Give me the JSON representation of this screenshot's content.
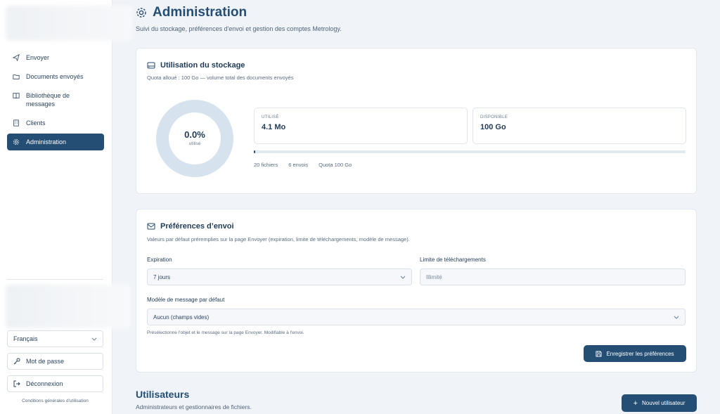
{
  "sidebar": {
    "items": [
      {
        "label": "Envoyer",
        "icon": "send-icon",
        "active": false
      },
      {
        "label": "Documents envoyés",
        "icon": "folder-icon",
        "active": false
      },
      {
        "label": "Bibliothèque de messages",
        "icon": "book-icon",
        "active": false
      },
      {
        "label": "Clients",
        "icon": "building-icon",
        "active": false
      },
      {
        "label": "Administration",
        "icon": "gear-icon",
        "active": true
      }
    ],
    "language": "Français",
    "password_label": "Mot de passe",
    "logout_label": "Déconnexion",
    "terms_label": "Conditions générales d'utilisation"
  },
  "header": {
    "title": "Administration",
    "subtitle": "Suivi du stockage, préférences d'envoi et gestion des comptes Metrology."
  },
  "storage": {
    "title": "Utilisation du stockage",
    "description": "Quota alloué : 100 Go — volume total des documents envoyés",
    "percent_label": "0.0%",
    "percent_caption": "utilisé",
    "used_key": "UTILISÉ",
    "used_value": "4.1 Mo",
    "available_key": "DISPONIBLE",
    "available_value": "100 Go",
    "usage_fraction": 0.002,
    "files": "20 fichiers",
    "sends": "6 envois",
    "quota": "Quota 100 Go"
  },
  "preferences": {
    "title": "Préférences d’envoi",
    "description": "Valeurs par défaut préremplies sur la page Envoyer (expiration, limite de téléchargements, modèle de message).",
    "expiration_label": "Expiration",
    "expiration_value": "7 jours",
    "limit_label": "Limite de téléchargements",
    "limit_placeholder": "Illimité",
    "template_label": "Modèle de message par défaut",
    "template_value": "Aucun (champs vides)",
    "template_hint": "Présélectionne l'objet et le message sur la page Envoyer. Modifiable à l'envoi.",
    "save_label": "Enregistrer les préférences"
  },
  "users": {
    "title": "Utilisateurs",
    "subtitle": "Administrateurs et gestionnaires de fichiers.",
    "new_user_label": "Nouvel utilisateur"
  },
  "colors": {
    "accent": "#244e73",
    "ring": "#d6e2ed",
    "background": "#f0f3f7"
  }
}
